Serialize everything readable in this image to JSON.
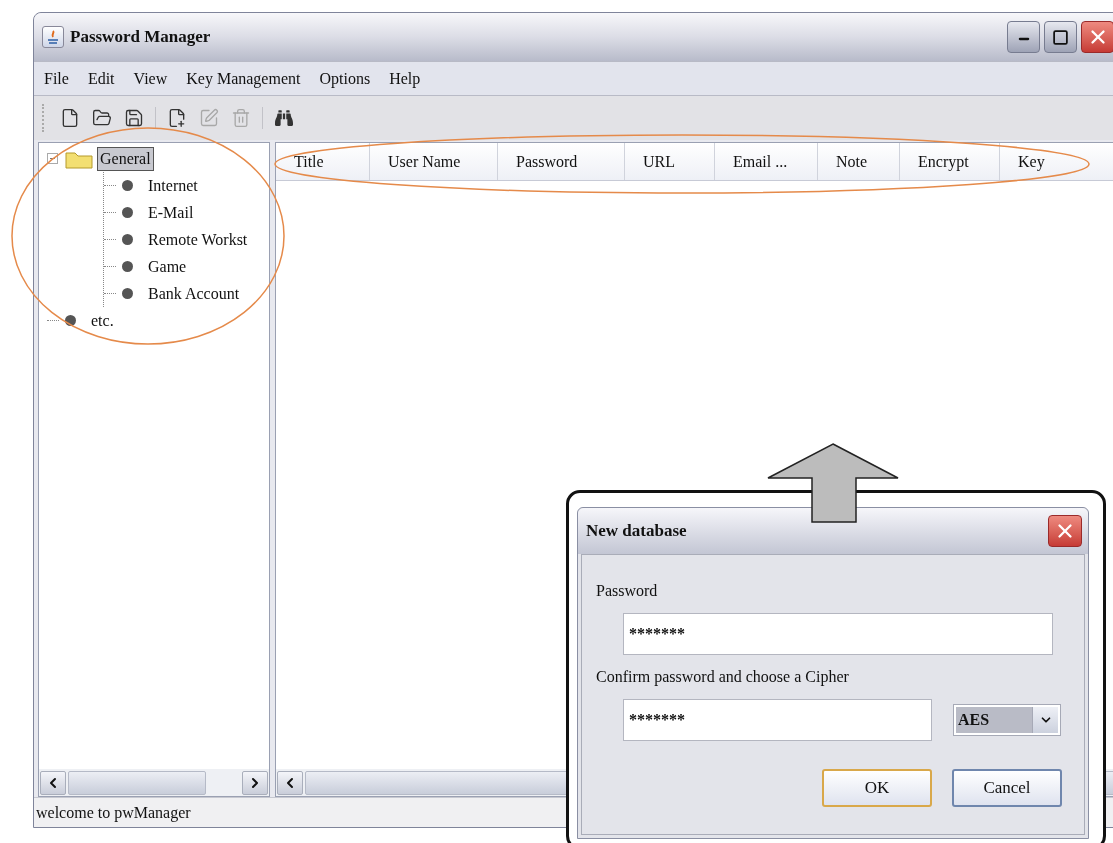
{
  "window": {
    "title": "Password Manager"
  },
  "menu": [
    "File",
    "Edit",
    "View",
    "Key Management",
    "Options",
    "Help"
  ],
  "toolbar": [
    [
      {
        "kind": "new_database",
        "disabled": false
      },
      {
        "kind": "open",
        "disabled": false
      },
      {
        "kind": "save",
        "disabled": false
      }
    ],
    [
      {
        "kind": "new_entry",
        "disabled": false
      },
      {
        "kind": "edit",
        "disabled": true
      },
      {
        "kind": "delete",
        "disabled": true
      }
    ],
    [
      {
        "kind": "find",
        "disabled": false
      }
    ]
  ],
  "tree": [
    {
      "label": "General",
      "expanded": true,
      "selected": true,
      "children": [
        {
          "label": "Internet",
          "selected": false
        },
        {
          "label": "E-Mail",
          "selected": false
        },
        {
          "label": "Remote Workst",
          "selected": false
        },
        {
          "label": "Game",
          "selected": false
        },
        {
          "label": "Bank Account",
          "selected": false
        }
      ]
    },
    {
      "label": "etc.",
      "selected": false
    }
  ],
  "table": {
    "columns": [
      "Title",
      "User Name",
      "Password",
      "URL",
      "Email ...",
      "Note",
      "Encrypt",
      "Key"
    ]
  },
  "status_bar": "welcome to pwManager",
  "dialog": {
    "title": "New database",
    "password_label": "Password",
    "password_value": "*******",
    "confirm_label": "Confirm password and choose a Cipher",
    "confirm_value": "*******",
    "cipher": "AES",
    "buttons": [
      {
        "label": "OK",
        "default": true
      },
      {
        "label": "Cancel",
        "default": false
      }
    ]
  }
}
